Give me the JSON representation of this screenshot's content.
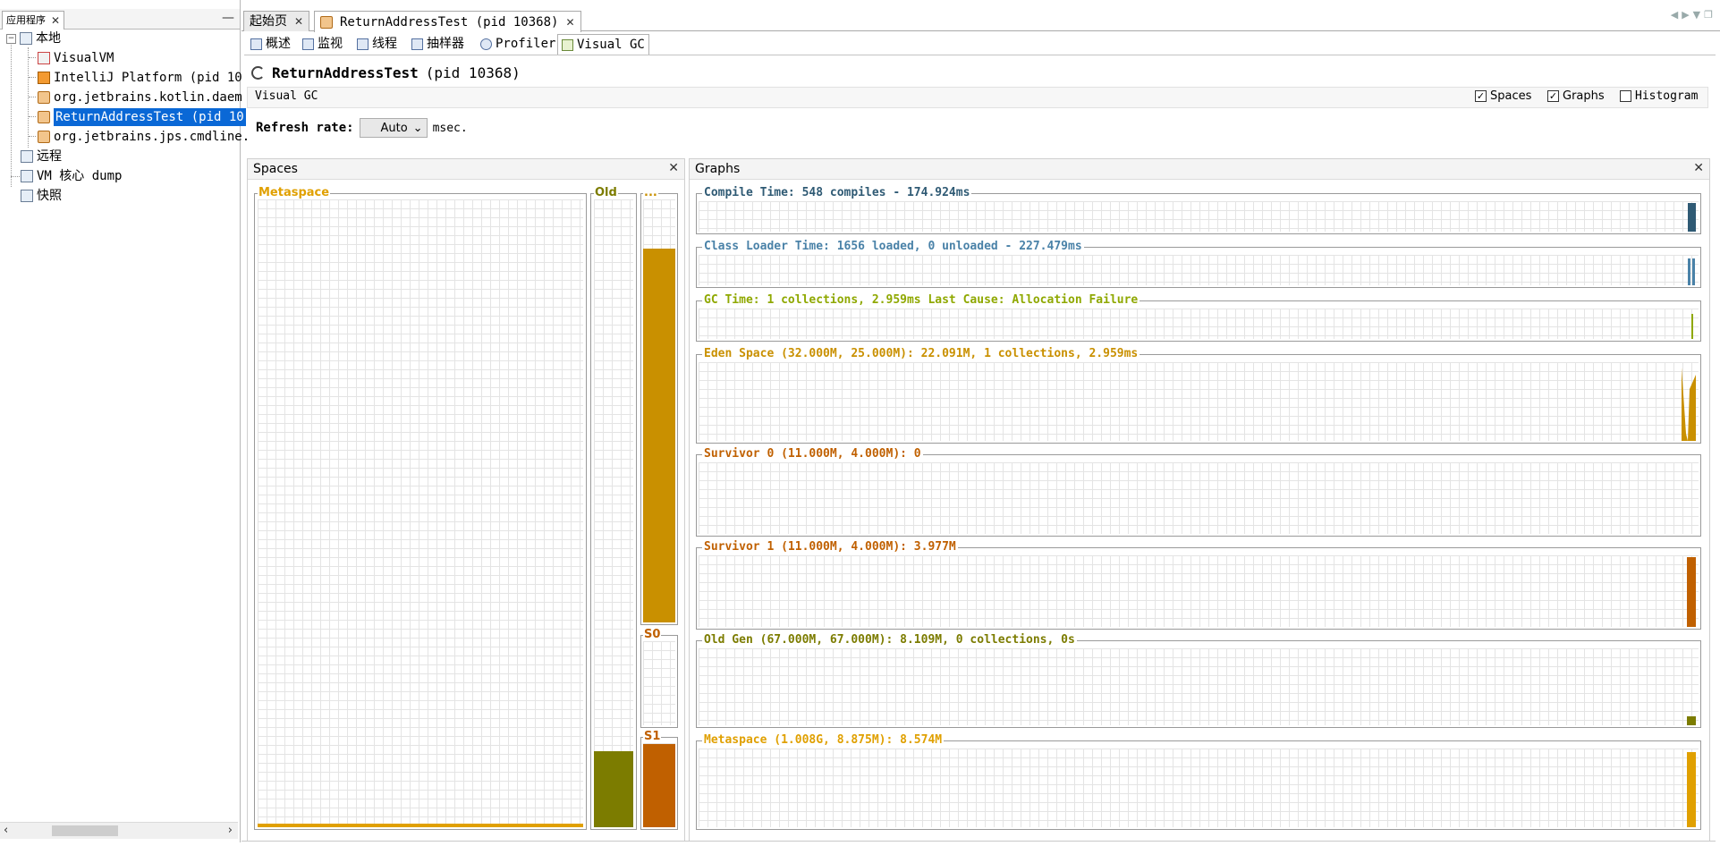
{
  "left_panel": {
    "tab_title": "应用程序",
    "tree": {
      "local": "本地",
      "local_children": [
        "VisualVM",
        "IntelliJ Platform (pid 10",
        "org.jetbrains.kotlin.daem",
        "ReturnAddressTest (pid 10",
        "org.jetbrains.jps.cmdline."
      ],
      "remote": "远程",
      "coredump": "VM 核心 dump",
      "snapshot": "快照"
    }
  },
  "doc_tabs": [
    "起始页",
    "ReturnAddressTest (pid 10368)"
  ],
  "view_tabs": [
    "概述",
    "监视",
    "线程",
    "抽样器",
    "Profiler",
    "Visual GC"
  ],
  "header": {
    "title": "ReturnAddressTest",
    "pid": "(pid 10368)",
    "section": "Visual GC",
    "options": [
      {
        "label": "Spaces",
        "checked": true
      },
      {
        "label": "Graphs",
        "checked": true
      },
      {
        "label": "Histogram",
        "checked": false
      }
    ],
    "refresh_label": "Refresh rate:",
    "refresh_value": "Auto",
    "refresh_unit": "msec."
  },
  "spaces": {
    "title": "Spaces",
    "metaspace": {
      "label": "Metaspace",
      "fill": 0.006,
      "color": "#e0a000"
    },
    "old": {
      "label": "Old",
      "fill": 0.121,
      "color": "#7c7c00"
    },
    "eden": {
      "label": "...",
      "fill": 0.884,
      "color": "#c99000"
    },
    "s0": {
      "label": "S0",
      "fill": 0.0,
      "color": "#c06000"
    },
    "s1": {
      "label": "S1",
      "fill": 0.994,
      "color": "#c06000"
    }
  },
  "graphs": {
    "title": "Graphs",
    "items": [
      {
        "label": "Compile Time: 548 compiles - 174.924ms",
        "color": "#2f5a74"
      },
      {
        "label": "Class Loader Time: 1656 loaded, 0 unloaded - 227.479ms",
        "color": "#4a82a8"
      },
      {
        "label": "GC Time: 1 collections, 2.959ms Last Cause: Allocation Failure",
        "color": "#8fa800"
      },
      {
        "label": "Eden Space (32.000M, 25.000M): 22.091M, 1 collections, 2.959ms",
        "color": "#c99000"
      },
      {
        "label": "Survivor 0 (11.000M, 4.000M): 0",
        "color": "#c06000"
      },
      {
        "label": "Survivor 1 (11.000M, 4.000M): 3.977M",
        "color": "#c06000"
      },
      {
        "label": "Old Gen (67.000M, 67.000M): 8.109M, 0 collections, 0s",
        "color": "#7c7c00"
      },
      {
        "label": "Metaspace (1.008G, 8.875M): 8.574M",
        "color": "#e0a000"
      }
    ]
  }
}
